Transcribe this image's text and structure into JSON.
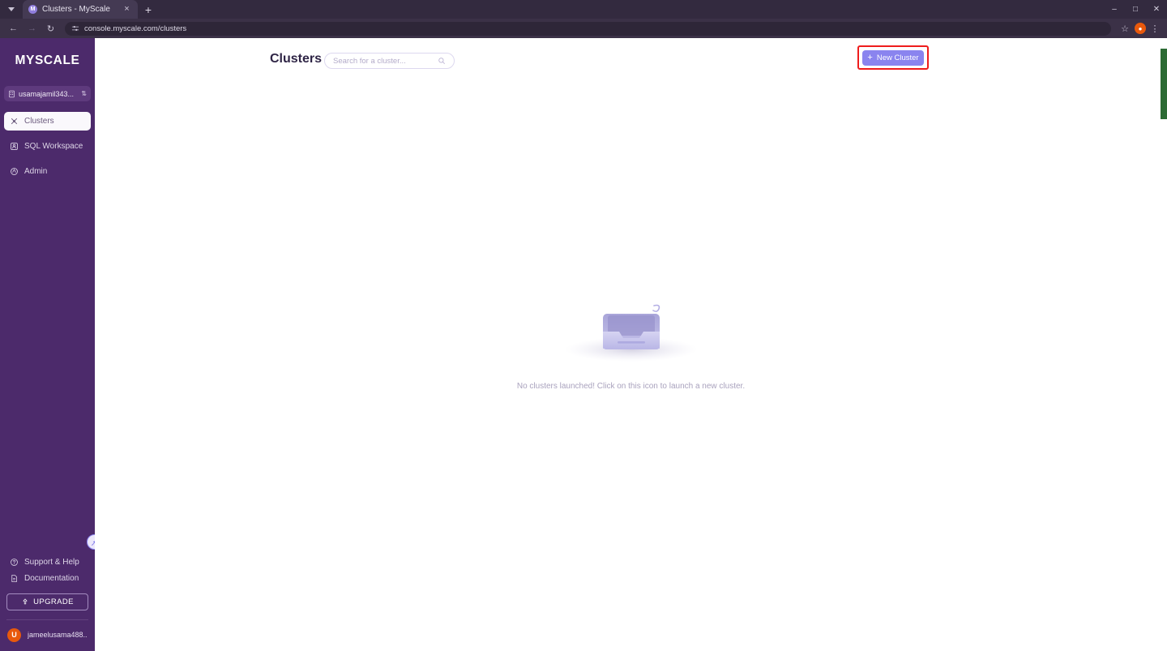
{
  "browser": {
    "tab": {
      "title": "Clusters - MyScale",
      "favicon_letter": "M",
      "close_label": "×"
    },
    "new_tab_label": "+",
    "tabstrip_menu_icon": "chevron-down-icon",
    "window_controls": {
      "minimize": "–",
      "maximize": "□",
      "close": "✕"
    },
    "nav": {
      "back": "←",
      "forward": "→",
      "reload": "↻"
    },
    "url": "console.myscale.com/clusters",
    "site_settings_icon": "tune-icon",
    "bookmark_icon": "star-icon",
    "profile_letter": "●",
    "menu_icon": "kebab-menu-icon"
  },
  "sidebar": {
    "brand": "MYSCALE",
    "org_selector": {
      "name": "usamajamil343...",
      "icon": "building-icon",
      "caret": "⇅"
    },
    "nav_items": [
      {
        "label": "Clusters",
        "icon": "clusters-icon",
        "active": true
      },
      {
        "label": "SQL Workspace",
        "icon": "sql-workspace-icon",
        "active": false
      },
      {
        "label": "Admin",
        "icon": "admin-shield-icon",
        "active": false
      }
    ],
    "pin_icon": "pin-icon",
    "footer_items": [
      {
        "label": "Support & Help",
        "icon": "help-circle-icon"
      },
      {
        "label": "Documentation",
        "icon": "document-icon"
      }
    ],
    "upgrade": {
      "label": "UPGRADE",
      "icon": "upgrade-arrow-icon"
    },
    "user": {
      "avatar_letter": "U",
      "name": "jameelusama488..."
    }
  },
  "main": {
    "title": "Clusters",
    "search": {
      "placeholder": "Search for a cluster...",
      "value": "",
      "icon": "search-icon"
    },
    "new_cluster": {
      "label": "New Cluster",
      "plus": "+"
    },
    "empty_state": {
      "illustration": "empty-tray-icon",
      "message": "No clusters launched! Click on this icon to launch a new cluster."
    }
  },
  "colors": {
    "sidebar_bg": "#4c2a6b",
    "accent_purple": "#8a84ef",
    "highlight_red": "#ef1c1c",
    "avatar_orange": "#e8590c",
    "scroll_green": "#2c6b34"
  }
}
